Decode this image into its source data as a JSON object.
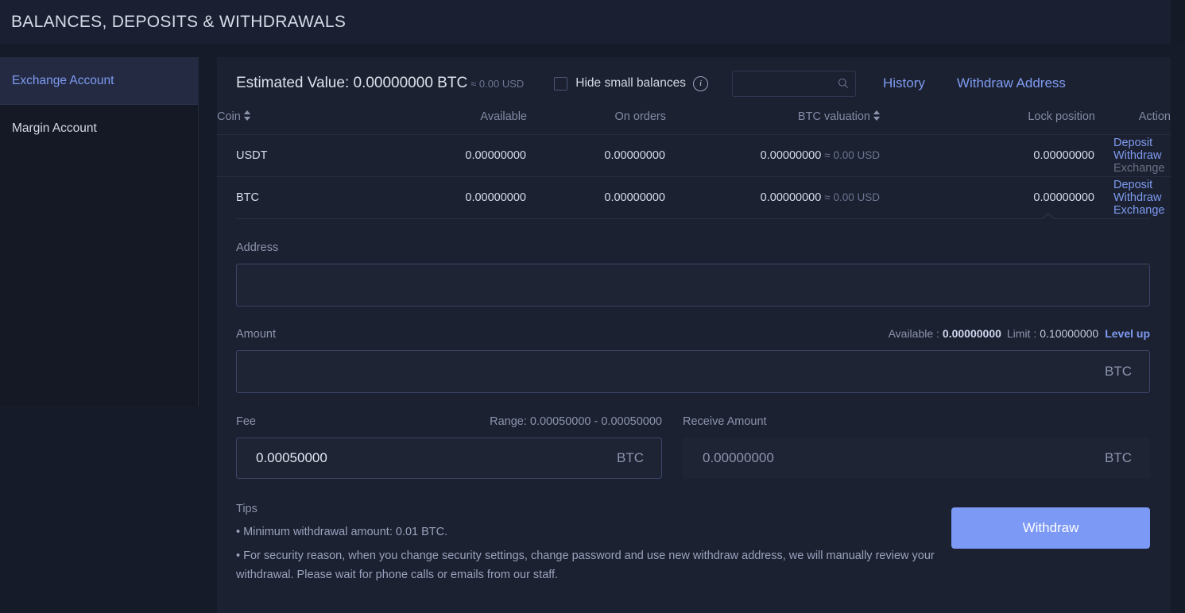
{
  "header": {
    "title": "BALANCES, DEPOSITS & WITHDRAWALS"
  },
  "sidebar": {
    "items": [
      {
        "label": "Exchange Account",
        "active": true
      },
      {
        "label": "Margin Account",
        "active": false
      }
    ]
  },
  "card_header": {
    "estimated_value": "Estimated Value: 0.00000000 BTC",
    "estimated_usd": "≈ 0.00 USD",
    "hide_small_balances": "Hide small balances",
    "info_icon": "info-icon",
    "search_value": "",
    "search_placeholder": "",
    "history_link": "History",
    "withdraw_address_link": "Withdraw Address"
  },
  "table": {
    "columns": {
      "coin": "Coin",
      "available": "Available",
      "on_orders": "On orders",
      "btc_valuation": "BTC valuation",
      "lock_position": "Lock position",
      "action": "Action"
    },
    "rows": [
      {
        "coin": "USDT",
        "available": "0.00000000",
        "on_orders": "0.00000000",
        "btc_valuation": "0.00000000",
        "btc_valuation_usd": "≈ 0.00 USD",
        "lock_position": "0.00000000",
        "deposit": "Deposit",
        "withdraw": "Withdraw",
        "exchange": "Exchange",
        "exchange_enabled": false
      },
      {
        "coin": "BTC",
        "available": "0.00000000",
        "on_orders": "0.00000000",
        "btc_valuation": "0.00000000",
        "btc_valuation_usd": "≈ 0.00 USD",
        "lock_position": "0.00000000",
        "deposit": "Deposit",
        "withdraw": "Withdraw",
        "exchange": "Exchange",
        "exchange_enabled": true
      }
    ]
  },
  "withdraw_panel": {
    "address_label": "Address",
    "address_value": "",
    "amount_label": "Amount",
    "amount_value": "",
    "amount_unit": "BTC",
    "available_key": "Available :",
    "available_value": "0.00000000",
    "limit_key": "Limit :",
    "limit_value": "0.10000000",
    "level_up": "Level up",
    "fee_label": "Fee",
    "fee_range": "Range: 0.00050000 - 0.00050000",
    "fee_value": "0.00050000",
    "fee_unit": "BTC",
    "receive_label": "Receive Amount",
    "receive_value": "0.00000000",
    "receive_unit": "BTC",
    "tips_title": "Tips",
    "tips": [
      "• Minimum withdrawal amount: 0.01 BTC.",
      "• For security reason, when you change security settings, change password and use new withdraw address, we will manually review your withdrawal. Please wait for phone calls or emails from our staff."
    ],
    "withdraw_button": "Withdraw"
  },
  "colors": {
    "accent_blue": "#7f9bf2",
    "button_blue": "#7b99f5",
    "page_bg": "#161b29",
    "card_bg": "#1b2130"
  }
}
